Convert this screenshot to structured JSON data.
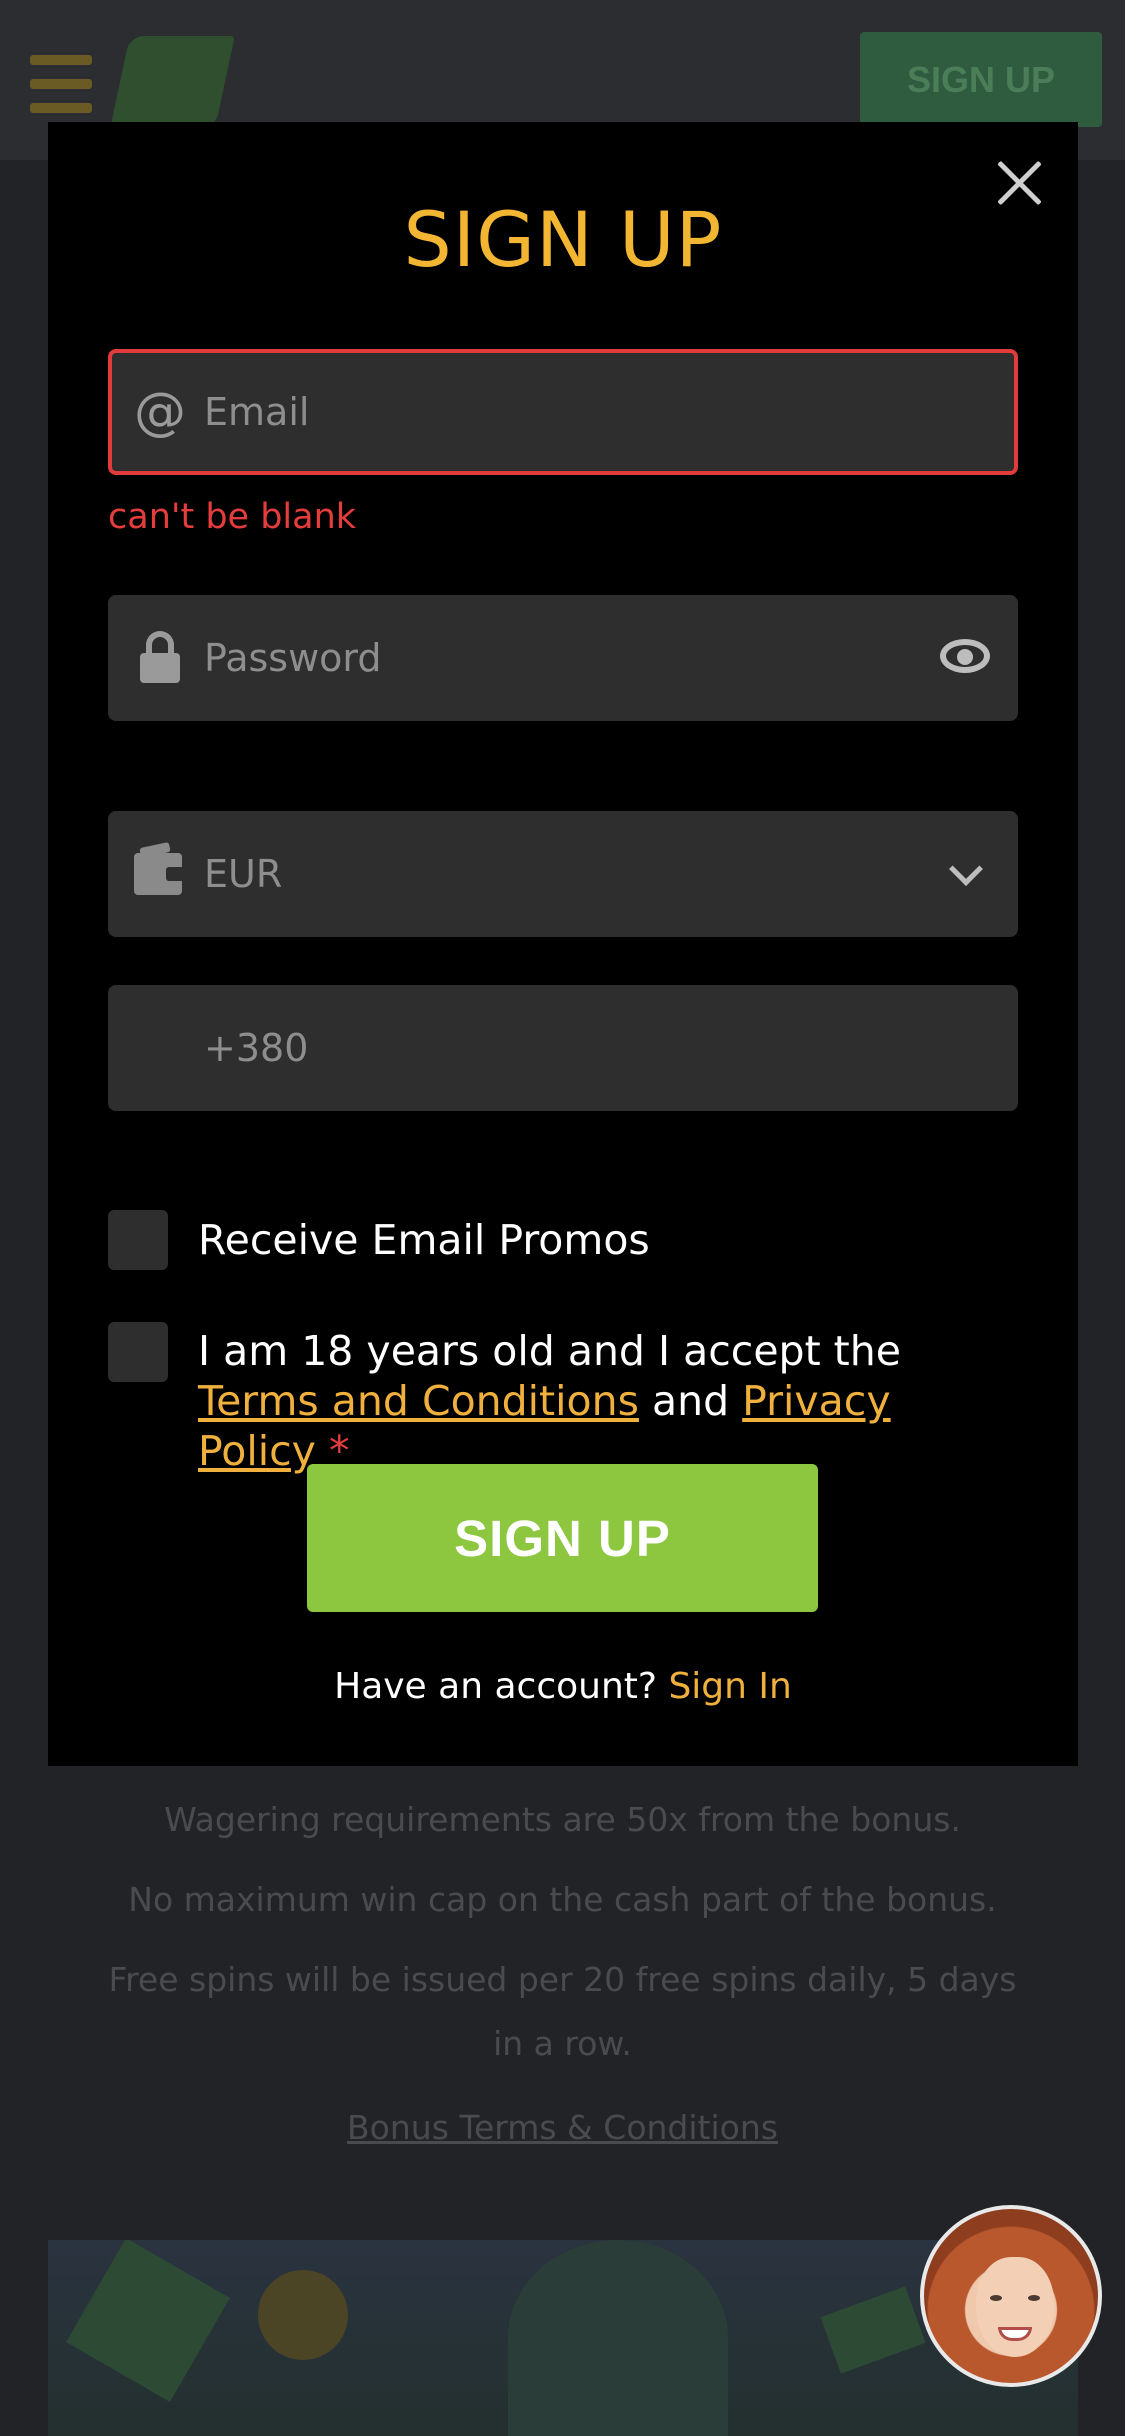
{
  "header": {
    "signup_label": "SIGN UP"
  },
  "background": {
    "lines": [
      "Wagering requirements are 50x from the bonus.",
      "No maximum win cap on the cash part of the bonus.",
      "Free spins will be issued per 20 free spins daily, 5 days",
      "in a row."
    ],
    "bonus_link": "Bonus Terms & Conditions"
  },
  "modal": {
    "title": "SIGN UP",
    "email": {
      "placeholder": "Email",
      "error": "can't be blank"
    },
    "password": {
      "placeholder": "Password"
    },
    "currency": {
      "value": "EUR"
    },
    "phone": {
      "placeholder": "+380"
    },
    "promos_label": "Receive Email Promos",
    "terms": {
      "prefix": "I am 18 years old and I accept the ",
      "terms_link": "Terms and Conditions",
      "and": " and ",
      "privacy_link": "Privacy Policy",
      "required": " *"
    },
    "submit_label": "SIGN UP",
    "footer": {
      "question": "Have an account? ",
      "signin_link": "Sign In"
    }
  },
  "colors": {
    "accent": "#f2b632",
    "submit": "#8dc63f",
    "error": "#e23b3b",
    "modal_bg": "#000000"
  },
  "icons": [
    "hamburger-icon",
    "close-icon",
    "at-icon",
    "lock-icon",
    "eye-icon",
    "wallet-icon",
    "chevron-down-icon"
  ]
}
